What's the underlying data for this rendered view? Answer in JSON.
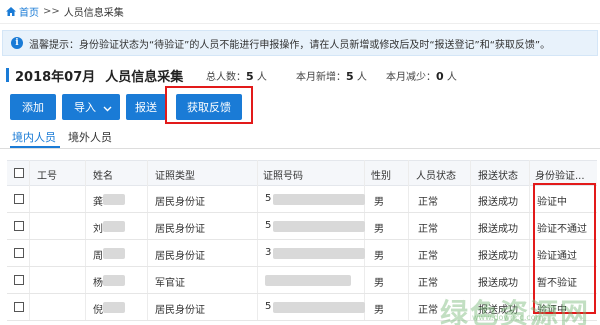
{
  "breadcrumb": {
    "home": "首页",
    "separator": ">>",
    "current": "人员信息采集"
  },
  "notice": {
    "icon": "info-icon",
    "text": "温馨提示：身份验证状态为“待验证”的人员不能进行申报操作，请在人员新增或修改后及时“报送登记”和“获取反馈”。"
  },
  "header": {
    "period": "2018年07月",
    "title": "人员信息采集",
    "total_label": "总人数：",
    "total_value": "5",
    "total_unit": "人",
    "new_label": "本月新增：",
    "new_value": "5",
    "new_unit": "人",
    "reduce_label": "本月减少：",
    "reduce_value": "0",
    "reduce_unit": "人"
  },
  "toolbar": {
    "add": "添加",
    "import": "导入",
    "report": "报送",
    "feedback": "获取反馈"
  },
  "tabs": [
    {
      "label": "境内人员",
      "active": true
    },
    {
      "label": "境外人员",
      "active": false
    }
  ],
  "table": {
    "columns": [
      "工号",
      "姓名",
      "证照类型",
      "证照号码",
      "性别",
      "人员状态",
      "报送状态",
      "身份验证..."
    ],
    "rows": [
      {
        "name": "龚",
        "id_type": "居民身份证",
        "id_no": "5",
        "gender": "男",
        "status": "正常",
        "report": "报送成功",
        "verify": "验证中"
      },
      {
        "name": "刘",
        "id_type": "居民身份证",
        "id_no": "5",
        "gender": "男",
        "status": "正常",
        "report": "报送成功",
        "verify": "验证不通过"
      },
      {
        "name": "周",
        "id_type": "居民身份证",
        "id_no": "3",
        "gender": "男",
        "status": "正常",
        "report": "报送成功",
        "verify": "验证通过"
      },
      {
        "name": "杨",
        "id_type": "军官证",
        "id_no": "",
        "gender": "男",
        "status": "正常",
        "report": "报送成功",
        "verify": "暂不验证"
      },
      {
        "name": "倪",
        "id_type": "居民身份证",
        "id_no": "5",
        "gender": "男",
        "status": "正常",
        "report": "报送成功",
        "verify": "验证中"
      }
    ]
  },
  "watermark": {
    "text": "绿色资源网",
    "sub": "www.downcc.com"
  }
}
